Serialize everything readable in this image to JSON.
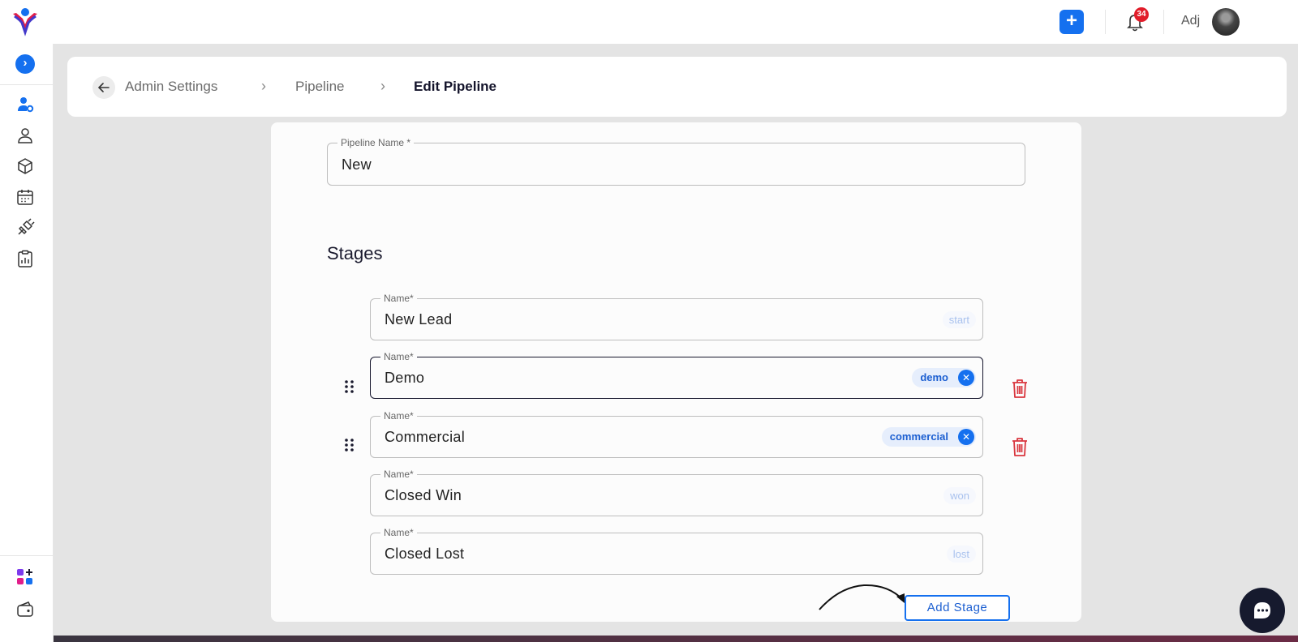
{
  "app": {
    "user_name": "Adj",
    "notification_count": "34"
  },
  "breadcrumb": {
    "items": [
      "Admin Settings",
      "Pipeline",
      "Edit Pipeline"
    ]
  },
  "pipeline": {
    "name_label": "Pipeline Name *",
    "name_value": "New"
  },
  "stages": {
    "title": "Stages",
    "name_label": "Name*",
    "items": [
      {
        "name": "New Lead",
        "tag": "start",
        "tag_type": "fixed",
        "deletable": false
      },
      {
        "name": "Demo",
        "tag": "demo",
        "tag_type": "chip",
        "deletable": true
      },
      {
        "name": "Commercial",
        "tag": "commercial",
        "tag_type": "chip",
        "deletable": true
      },
      {
        "name": "Closed Win",
        "tag": "won",
        "tag_type": "fixed",
        "deletable": false
      },
      {
        "name": "Closed Lost",
        "tag": "lost",
        "tag_type": "fixed",
        "deletable": false
      }
    ],
    "add_label": "Add Stage"
  },
  "icons": {
    "sidebar": [
      "user-settings-icon",
      "user-icon",
      "cube-icon",
      "calendar-icon",
      "integration-icon",
      "report-clipboard-icon",
      "apps-add-icon",
      "wallet-icon"
    ],
    "toolbar": [
      "plus-icon",
      "bell-icon"
    ],
    "stage_row": [
      "drag-handle-icon",
      "trash-icon",
      "close-icon"
    ]
  },
  "colors": {
    "accent": "#1570ef",
    "danger": "#d9363e",
    "badge": "#e11d2a",
    "dark": "#161a2e"
  }
}
